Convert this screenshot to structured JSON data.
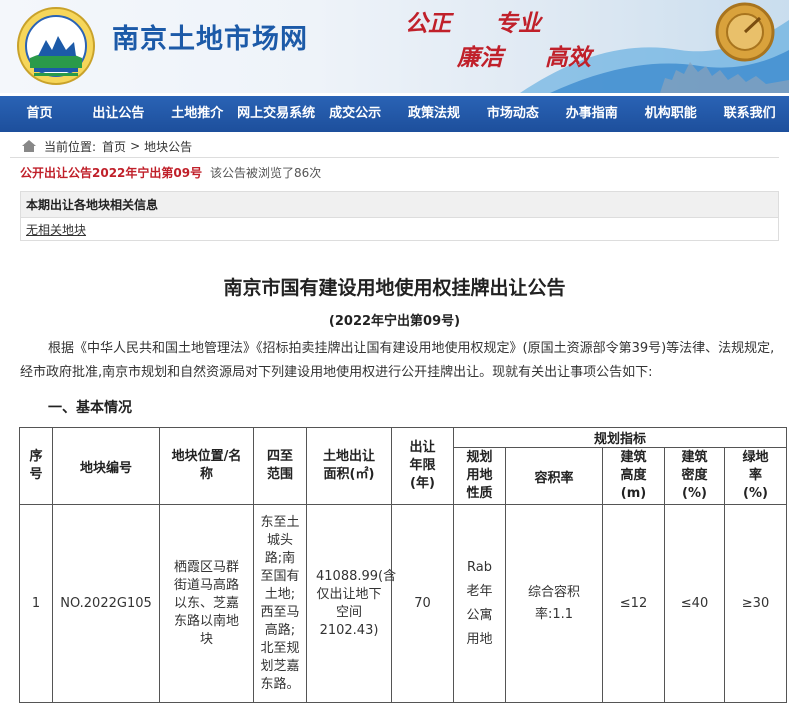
{
  "header": {
    "site_title": "南京土地市场网",
    "slogan": [
      "公正",
      "专业",
      "廉洁",
      "高效"
    ]
  },
  "nav": [
    "首页",
    "出让公告",
    "土地推介",
    "网上交易系统",
    "成交公示",
    "政策法规",
    "市场动态",
    "办事指南",
    "机构职能",
    "联系我们"
  ],
  "breadcrumb": {
    "label": "当前位置:",
    "home": "首页",
    "separator": ">",
    "current": "地块公告"
  },
  "notice": {
    "title": "公开出让公告2022年宁出第09号",
    "views": "该公告被浏览了86次"
  },
  "related": {
    "heading": "本期出让各地块相关信息",
    "link": "无相关地块"
  },
  "document": {
    "title": "南京市国有建设用地使用权挂牌出让公告",
    "subtitle": "(2022年宁出第09号)",
    "paragraph": "根据《中华人民共和国土地管理法》《招标拍卖挂牌出让国有建设用地使用权规定》(原国土资源部令第39号)等法律、法规规定,经市政府批准,南京市规划和自然资源局对下列建设用地使用权进行公开挂牌出让。现就有关出让事项公告如下:",
    "section1": "一、基本情况"
  },
  "table": {
    "headers": {
      "seq": "序号",
      "parcel_no": "地块编号",
      "location": "地块位置/名称",
      "boundary": "四至范围",
      "area": "土地出让面积(㎡)",
      "term": "出让年限(年)",
      "planning": "规划指标",
      "use": "规划用地性质",
      "far": "容积率",
      "height": "建筑高度(m)",
      "density": "建筑密度(%)",
      "green": "绿地率(%)"
    },
    "rows": [
      {
        "seq": "1",
        "parcel_no": "NO.2022G105",
        "location": "栖霞区马群街道马高路以东、芝嘉东路以南地块",
        "boundary": "东至土城头路;南至国有土地;西至马高路;北至规划芝嘉东路。",
        "area": "41088.99(含仅出让地下空间2102.43)",
        "term": "70",
        "use": "Rab老年公寓用地",
        "far": "综合容积率:1.1",
        "height": "≤12",
        "density": "≤40",
        "green": "≥30"
      }
    ]
  }
}
